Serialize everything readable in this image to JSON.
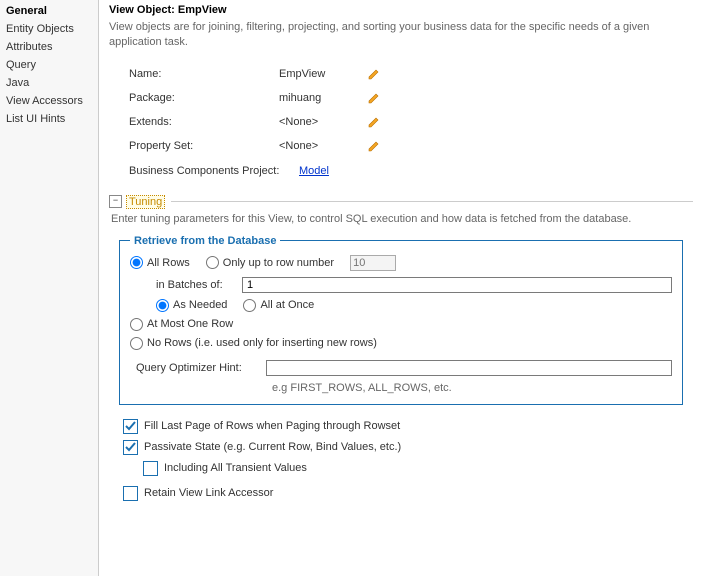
{
  "sidebar": {
    "items": [
      {
        "label": "General",
        "selected": true
      },
      {
        "label": "Entity Objects"
      },
      {
        "label": "Attributes"
      },
      {
        "label": "Query"
      },
      {
        "label": "Java"
      },
      {
        "label": "View Accessors"
      },
      {
        "label": "List UI Hints"
      }
    ]
  },
  "main": {
    "title": "View Object: EmpView",
    "description": "View objects are for joining, filtering, projecting, and sorting your business data for the specific needs of a given application task.",
    "props": {
      "name_label": "Name:",
      "name_value": "EmpView",
      "package_label": "Package:",
      "package_value": "mihuang",
      "extends_label": "Extends:",
      "extends_value": "<None>",
      "propset_label": "Property Set:",
      "propset_value": "<None>",
      "bcproj_label": "Business Components Project:",
      "bcproj_value": "Model"
    }
  },
  "tuning": {
    "title": "Tuning",
    "description": "Enter tuning parameters for this View, to control SQL execution and how data is fetched from the database.",
    "retrieve_title": "Retrieve from the Database",
    "all_rows": "All Rows",
    "only_up_to": "Only up to row number",
    "row_number_placeholder": "10",
    "in_batches_label": "in Batches of:",
    "batches_value": "1",
    "as_needed": "As Needed",
    "all_at_once": "All at Once",
    "at_most_one": "At Most One Row",
    "no_rows": "No Rows (i.e. used only for inserting new rows)",
    "hint_label": "Query Optimizer Hint:",
    "hint_example": "e.g FIRST_ROWS, ALL_ROWS, etc."
  },
  "options": {
    "fill_last": "Fill Last Page of Rows when Paging through Rowset",
    "passivate": "Passivate State (e.g. Current Row, Bind Values, etc.)",
    "incl_transient": "Including All Transient Values",
    "retain_accessor": "Retain View Link Accessor"
  }
}
